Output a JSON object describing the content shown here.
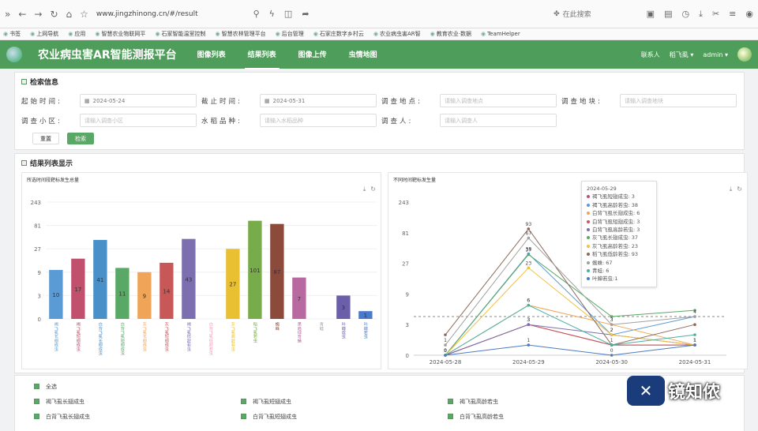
{
  "browser": {
    "url": "www.jingzhinong.cn/#/result",
    "search_placeholder": "在此搜索",
    "bookmarks": [
      "书签",
      "上网导航",
      "应用",
      "智慧农业物联网平",
      "石家智能温室控制",
      "智慧农林管理平台",
      "后台管理",
      "石家庄数字乡村云",
      "农业病虫害AR智",
      "教育农业·数据",
      "TeamHelper"
    ]
  },
  "nav": {
    "title": "农业病虫害AR智能测报平台",
    "menu": [
      "图像列表",
      "结果列表",
      "图像上传",
      "虫情地图"
    ],
    "active": "结果列表",
    "contact": "联系人",
    "user1": "稻飞虱",
    "user2": "admin"
  },
  "search": {
    "heading": "检索信息",
    "fields": [
      {
        "label": "起始时间:",
        "value": "2024-05-24",
        "placeholder": ""
      },
      {
        "label": "截止时间:",
        "value": "2024-05-31",
        "placeholder": ""
      },
      {
        "label": "调查地点:",
        "value": "",
        "placeholder": "请输入调查地点"
      },
      {
        "label": "调查地块:",
        "value": "",
        "placeholder": "请输入调查地块"
      },
      {
        "label": "调查小区:",
        "value": "",
        "placeholder": "请输入调查小区"
      },
      {
        "label": "水稻品种:",
        "value": "",
        "placeholder": "请输入水稻品种"
      },
      {
        "label": "调查人:",
        "value": "",
        "placeholder": "请输入调查人"
      }
    ],
    "reset": "重置",
    "search": "检索"
  },
  "results_heading": "结果列表显示",
  "chart_data": [
    {
      "type": "bar",
      "title": "所选时间段靶标发生总量",
      "yscale": "log3",
      "yticks": [
        0,
        3,
        9,
        27,
        81,
        243
      ],
      "categories": [
        "褐飞虱长翅成虫",
        "褐飞虱短翅成虫",
        "白背飞虱长翅成虫",
        "白背飞虱短翅成虫",
        "灰飞虱长翅成虫",
        "灰飞虱短翅成虫",
        "褐飞虱低龄若虫",
        "白背飞虱低龄若虫",
        "灰飞虱高龄若虫",
        "稻飞虱若虫",
        "蜘蛛",
        "黑肩绿盲蝽",
        "青蛙",
        "叶蝉成虫",
        "叶蝉若虫"
      ],
      "values": [
        10,
        17,
        41,
        11,
        9,
        14,
        43,
        0,
        27,
        101,
        87,
        7,
        0,
        3,
        1
      ],
      "colors": [
        "#5b9bd5",
        "#c0506e",
        "#4a90c8",
        "#5aa865",
        "#f0a458",
        "#c85858",
        "#7b6fb0",
        "#f0a0c0",
        "#e8c032",
        "#78ac4a",
        "#8b4a3a",
        "#b86aa0",
        "#999999",
        "#6a5fa8",
        "#4a7ac8"
      ]
    },
    {
      "type": "line",
      "title": "不同时间靶标发生量",
      "yscale": "log3",
      "yticks": [
        0,
        3,
        9,
        27,
        81,
        243
      ],
      "x": [
        "2024-05-28",
        "2024-05-29",
        "2024-05-30",
        "2024-05-31"
      ],
      "series": [
        {
          "name": "褐飞虱短翅成虫",
          "values": [
            0,
            3,
            1,
            1
          ],
          "color": "#c0506e"
        },
        {
          "name": "褐飞虱高龄若虫",
          "values": [
            0,
            38,
            2,
            4
          ],
          "color": "#5b9bd5"
        },
        {
          "name": "白背飞虱长翅成虫",
          "values": [
            0,
            6,
            3,
            1
          ],
          "color": "#f0a458"
        },
        {
          "name": "白背飞虱短翅成虫",
          "values": [
            0,
            3,
            1,
            1
          ],
          "color": "#c85858"
        },
        {
          "name": "白背飞虱高龄若虫",
          "values": [
            0,
            3,
            2,
            1
          ],
          "color": "#7b6fb0"
        },
        {
          "name": "灰飞虱长翅成虫",
          "values": [
            0,
            37,
            4,
            5
          ],
          "color": "#5aa865"
        },
        {
          "name": "灰飞虱高龄若虫",
          "values": [
            0,
            23,
            2,
            1
          ],
          "color": "#f0c040"
        },
        {
          "name": "稻飞虱低龄若虫",
          "values": [
            2,
            93,
            1,
            3
          ],
          "color": "#8b6a5a"
        },
        {
          "name": "蜘蛛",
          "values": [
            1,
            67,
            3,
            4
          ],
          "color": "#a0a0a0"
        },
        {
          "name": "青蛙",
          "values": [
            0,
            6,
            1,
            2
          ],
          "color": "#4ab0a0"
        },
        {
          "name": "叶蝉若虫",
          "values": [
            0,
            1,
            0,
            1
          ],
          "color": "#4a7ac8"
        }
      ],
      "tooltip": {
        "date": "2024-05-29",
        "rows": [
          "褐飞虱短翅成虫: 3",
          "褐飞虱高龄若虫: 38",
          "白背飞虱长翅成虫: 6",
          "白背飞虱短翅成虫: 3",
          "白背飞虱高龄若虫: 3",
          "灰飞虱长翅成虫: 37",
          "灰飞虱高龄若虫: 23",
          "稻飞虱低龄若虫: 93",
          "蜘蛛: 67",
          "青蛙: 6",
          "叶蝉若虫:1"
        ]
      }
    }
  ],
  "legend": {
    "all": "全选",
    "items": [
      "褐飞虱长翅成虫",
      "褐飞虱短翅成虫",
      "褐飞虱高龄若虫",
      "白背飞虱长翅成虫",
      "白背飞虱短翅成虫",
      "白背飞虱高龄若虫"
    ]
  },
  "watermark": "镜知侬"
}
